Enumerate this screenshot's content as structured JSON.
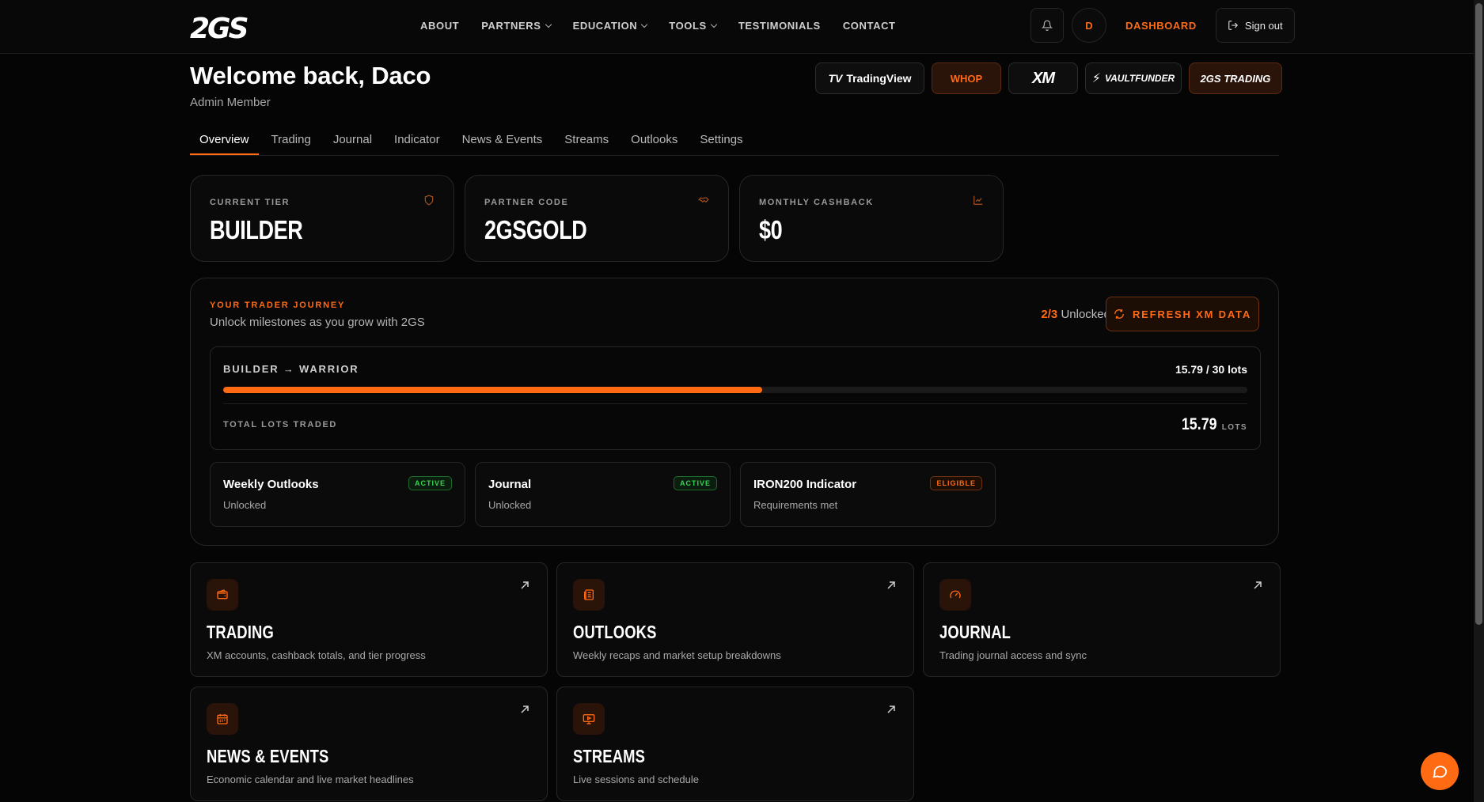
{
  "brand": {
    "logo_text": "2GS",
    "accent_color": "#ff6a13"
  },
  "nav": {
    "links": [
      {
        "label": "ABOUT",
        "dropdown": false
      },
      {
        "label": "PARTNERS",
        "dropdown": true
      },
      {
        "label": "EDUCATION",
        "dropdown": true
      },
      {
        "label": "TOOLS",
        "dropdown": true
      },
      {
        "label": "TESTIMONIALS",
        "dropdown": false
      },
      {
        "label": "CONTACT",
        "dropdown": false
      }
    ],
    "avatar_initial": "D",
    "dashboard_label": "DASHBOARD",
    "signout_label": "Sign out"
  },
  "header": {
    "welcome": "Welcome back, Daco",
    "role": "Admin Member",
    "partners": [
      "TradingView",
      "WHOP",
      "XM",
      "VAULTFUNDER",
      "2GS TRADING"
    ]
  },
  "tabs": {
    "items": [
      "Overview",
      "Trading",
      "Journal",
      "Indicator",
      "News & Events",
      "Streams",
      "Outlooks",
      "Settings"
    ],
    "active": "Overview"
  },
  "stats": {
    "tier": {
      "label": "CURRENT TIER",
      "value": "BUILDER",
      "icon": "shield-icon"
    },
    "partner_code": {
      "label": "PARTNER CODE",
      "value": "2GSGOLD",
      "icon": "handshake-icon"
    },
    "cashback": {
      "label": "MONTHLY CASHBACK",
      "value": "$0",
      "icon": "trend-chart-icon"
    }
  },
  "journey": {
    "kicker": "YOUR TRADER JOURNEY",
    "subtitle": "Unlock milestones as you grow with 2GS",
    "unlocked_count": "2/3",
    "unlocked_label": "Unlocked",
    "refresh_label": "REFRESH XM DATA",
    "progress": {
      "label": "BUILDER → WARRIOR",
      "value_text": "15.79 / 30 lots",
      "fraction": 0.5263
    },
    "total_lots": {
      "label": "TOTAL LOTS TRADED",
      "value": "15.79",
      "unit": "LOTS"
    },
    "milestones": [
      {
        "title": "Weekly Outlooks",
        "subtitle": "Unlocked",
        "badge": "ACTIVE",
        "status": "active"
      },
      {
        "title": "Journal",
        "subtitle": "Unlocked",
        "badge": "ACTIVE",
        "status": "active"
      },
      {
        "title": "IRON200 Indicator",
        "subtitle": "Requirements met",
        "badge": "ELIGIBLE",
        "status": "eligible"
      }
    ]
  },
  "features": [
    {
      "title": "TRADING",
      "subtitle": "XM accounts, cashback totals, and tier progress",
      "icon": "wallet-icon"
    },
    {
      "title": "OUTLOOKS",
      "subtitle": "Weekly recaps and market setup breakdowns",
      "icon": "newspaper-icon"
    },
    {
      "title": "JOURNAL",
      "subtitle": "Trading journal access and sync",
      "icon": "gauge-icon"
    },
    {
      "title": "NEWS & EVENTS",
      "subtitle": "Economic calendar and live market headlines",
      "icon": "calendar-icon"
    },
    {
      "title": "STREAMS",
      "subtitle": "Live sessions and schedule",
      "icon": "monitor-play-icon"
    }
  ]
}
